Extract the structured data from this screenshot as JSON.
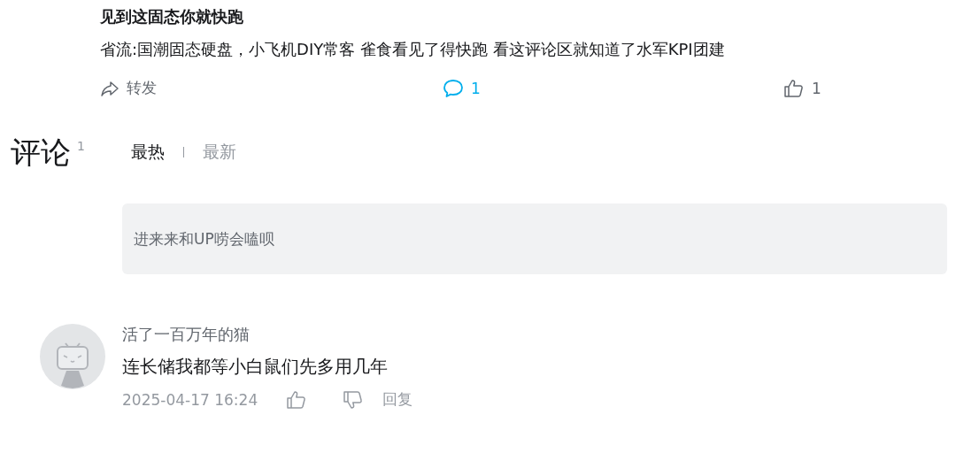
{
  "post": {
    "title": "见到这固态你就快跑",
    "text": "省流:国潮固态硬盘，小飞机DIY常客 雀食看见了得快跑 看这评论区就知道了水军KPI团建",
    "actions": [
      {
        "kind": "share",
        "label": "转发"
      },
      {
        "kind": "comment",
        "label": "1"
      },
      {
        "kind": "like",
        "label": "1"
      }
    ]
  },
  "comments_header": {
    "title": "评论",
    "count": "1",
    "sort_tabs": [
      {
        "label": "最热",
        "selected": true
      },
      {
        "label": "最新",
        "selected": false
      }
    ]
  },
  "comment_input": {
    "placeholder": "进来来和UP唠会嗑呗"
  },
  "comments": [
    {
      "author": "活了一百万年的猫",
      "text": "连长储我都等小白鼠们先多用几年",
      "time": "2025-04-17 16:24",
      "reply_label": "回复"
    }
  ]
}
